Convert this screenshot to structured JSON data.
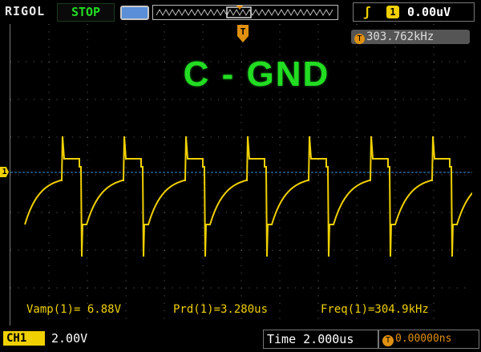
{
  "brand": "RIGOL",
  "status": "STOP",
  "trigger": {
    "channel": "1",
    "level": "0.00uV",
    "edge_icon": "rising-edge-icon"
  },
  "frequency_display": "303.762kHz",
  "trigger_marker": "T",
  "overlay_title": "C - GND",
  "measurements": {
    "vamp": "Vamp(1)= 6.88V",
    "prd": "Prd(1)=3.280us",
    "freq": "Freq(1)=304.9kHz"
  },
  "channel": {
    "label": "CH1",
    "scale": "2.00V",
    "marker": "1"
  },
  "timebase": "Time 2.000us",
  "trigger_position": "0.00000ns",
  "colors": {
    "trace": "#f0d000",
    "status": "#22dd22",
    "trigger": "#e09010",
    "ground_line": "#3a8fd8"
  }
}
